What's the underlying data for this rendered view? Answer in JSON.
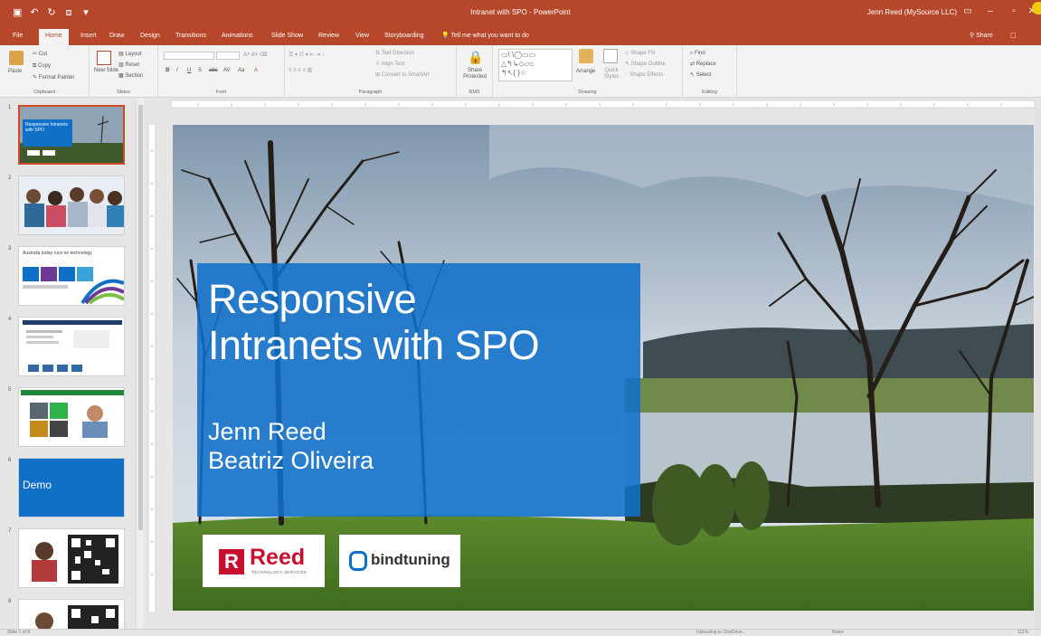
{
  "titlebar": {
    "document_title": "Intranet with SPO - PowerPoint",
    "user": "Jenn Reed (MySource LLC)",
    "quick_access": [
      "save-icon",
      "undo-icon",
      "redo-icon",
      "start-from-beginning-icon",
      "customize-icon"
    ],
    "bg_color": "#b7472a"
  },
  "tabs": {
    "items": [
      "File",
      "Home",
      "Insert",
      "Draw",
      "Design",
      "Transitions",
      "Animations",
      "Slide Show",
      "Review",
      "View",
      "Storyboarding"
    ],
    "active": "Home",
    "tell_me": "Tell me what you want to do",
    "share": "Share"
  },
  "ribbon": {
    "clipboard": {
      "paste": "Paste",
      "cut": "Cut",
      "copy": "Copy",
      "format_painter": "Format Painter",
      "label": "Clipboard"
    },
    "slides": {
      "new_slide": "New Slide",
      "layout": "Layout",
      "reset": "Reset",
      "section": "Section",
      "label": "Slides"
    },
    "font": {
      "label": "Font",
      "bold": "B",
      "italic": "I",
      "underline": "U",
      "strike": "S",
      "abc": "abc",
      "aa": "Aa",
      "a_color": "A"
    },
    "paragraph": {
      "label": "Paragraph",
      "text_direction": "Text Direction",
      "align_text": "Align Text",
      "smartart": "Convert to SmartArt"
    },
    "rms": {
      "share_protected": "Share Protected",
      "label": "RMS"
    },
    "drawing": {
      "arrange": "Arrange",
      "quick_styles": "Quick Styles",
      "shape_fill": "Shape Fill",
      "shape_outline": "Shape Outline",
      "shape_effects": "Shape Effects",
      "label": "Drawing"
    },
    "editing": {
      "find": "Find",
      "replace": "Replace",
      "select": "Select",
      "label": "Editing"
    }
  },
  "thumbnails": [
    {
      "num": "1",
      "title": "Responsive Intranets with SPO"
    },
    {
      "num": "2"
    },
    {
      "num": "3",
      "title": "Australia today runs on technology"
    },
    {
      "num": "4"
    },
    {
      "num": "5"
    },
    {
      "num": "6",
      "title": "Demo"
    },
    {
      "num": "7"
    },
    {
      "num": "8"
    }
  ],
  "slide": {
    "title_line1": "Responsive",
    "title_line2": "Intranets with SPO",
    "author1": "Jenn Reed",
    "author2": "Beatriz Oliveira",
    "logo_reed_word": "Reed",
    "logo_reed_sub": "TECHNOLOGY SERVICES",
    "logo_reed_letter": "R",
    "logo_bindtuning": "bindtuning",
    "title_box_color": "#1070c8"
  },
  "status": {
    "slide_of": "Slide 1 of 8",
    "upload": "Uploading to OneDrive...",
    "notes": "Notes",
    "zoom": "111%"
  }
}
